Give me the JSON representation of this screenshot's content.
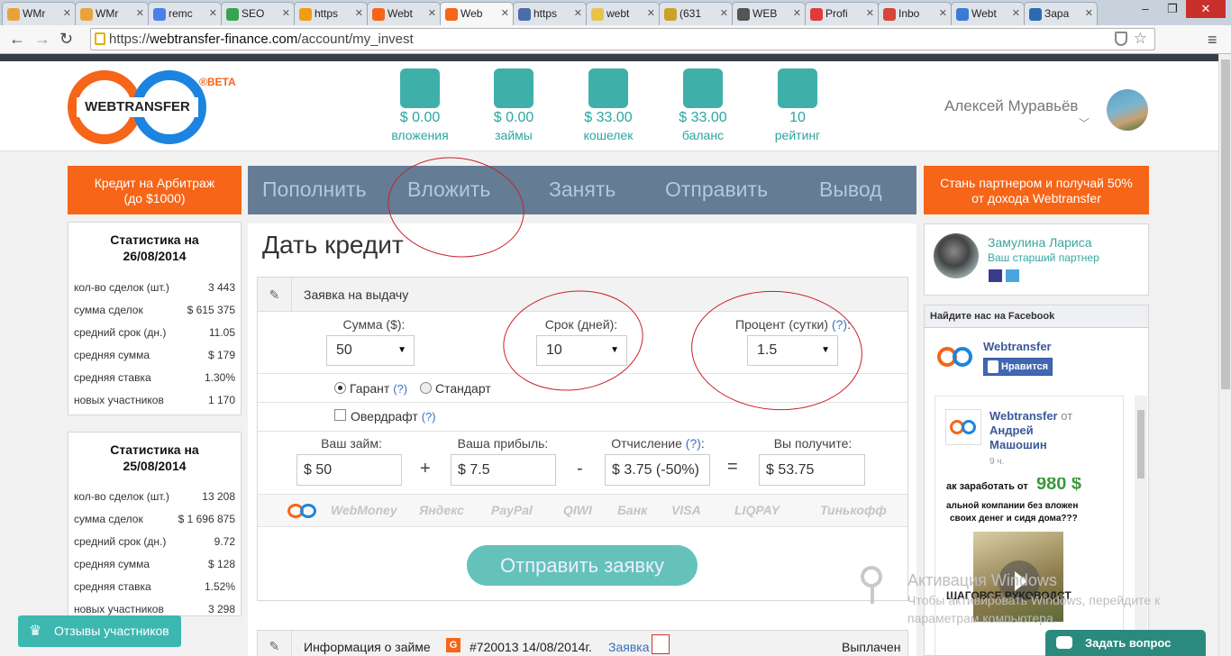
{
  "browser": {
    "tabs": [
      {
        "label": "WMr",
        "favcolor": "#e9a23b"
      },
      {
        "label": "WMr",
        "favcolor": "#e9a23b"
      },
      {
        "label": "remc",
        "favcolor": "#4a80e8"
      },
      {
        "label": "SEO",
        "favcolor": "#3aa351"
      },
      {
        "label": "https",
        "favcolor": "#f39c12"
      },
      {
        "label": "Webt",
        "favcolor": "#f66518"
      },
      {
        "label": "Web",
        "favcolor": "#f66518"
      },
      {
        "label": "https",
        "favcolor": "#4a6ea8"
      },
      {
        "label": "webt",
        "favcolor": "#e8c34a"
      },
      {
        "label": "(631",
        "favcolor": "#c9a227"
      },
      {
        "label": "WEB",
        "favcolor": "#555555"
      },
      {
        "label": "Profi",
        "favcolor": "#e23b3b"
      },
      {
        "label": "Inbo",
        "favcolor": "#d44638"
      },
      {
        "label": "Webt",
        "favcolor": "#3a7bd5"
      },
      {
        "label": "Зара",
        "favcolor": "#2b6cb0"
      }
    ],
    "active_tab": 6,
    "url_scheme": "https://",
    "url_host": "webtransfer-finance.com",
    "url_path": "/account/my_invest",
    "window_controls": {
      "minimize": "–",
      "maximize": "❐",
      "close": "✕"
    }
  },
  "header": {
    "logo_text": "WEBTRANSFER",
    "logo_badge": "®BETA",
    "stats": [
      {
        "icon": "piggy-bank-icon",
        "value": "$ 0.00",
        "label": "вложения"
      },
      {
        "icon": "coins-icon",
        "value": "$ 0.00",
        "label": "займы"
      },
      {
        "icon": "safe-icon",
        "value": "$ 33.00",
        "label": "кошелек"
      },
      {
        "icon": "abacus-icon",
        "value": "$ 33.00",
        "label": "баланс"
      },
      {
        "icon": "rating-chart-icon",
        "value": "10",
        "label": "рейтинг"
      }
    ],
    "user_name": "Алексей Муравьёв"
  },
  "promo_left": {
    "line1": "Кредит на Арбитраж",
    "line2": "(до $1000)"
  },
  "promo_right": {
    "line1": "Стань партнером и получай 50%",
    "line2": "от дохода Webtransfer"
  },
  "nav": [
    "Пополнить",
    "Вложить",
    "Занять",
    "Отправить",
    "Вывод"
  ],
  "stats_panels": [
    {
      "title1": "Статистика на",
      "title2": "26/08/2014",
      "rows": [
        {
          "label": "кол-во сделок (шт.)",
          "value": "3 443"
        },
        {
          "label": "сумма сделок",
          "value": "$ 615 375"
        },
        {
          "label": "средний срок (дн.)",
          "value": "11.05"
        },
        {
          "label": "средняя сумма",
          "value": "$ 179"
        },
        {
          "label": "средняя ставка",
          "value": "1.30%"
        },
        {
          "label": "новых участников",
          "value": "1 170"
        }
      ]
    },
    {
      "title1": "Статистика на",
      "title2": "25/08/2014",
      "rows": [
        {
          "label": "кол-во сделок (шт.)",
          "value": "13 208"
        },
        {
          "label": "сумма сделок",
          "value": "$ 1 696 875"
        },
        {
          "label": "средний срок (дн.)",
          "value": "9.72"
        },
        {
          "label": "средняя сумма",
          "value": "$ 128"
        },
        {
          "label": "средняя ставка",
          "value": "1.52%"
        },
        {
          "label": "новых участников",
          "value": "3 298"
        }
      ]
    }
  ],
  "reviews_button": "Отзывы участников",
  "main": {
    "title": "Дать кредит",
    "section_title": "Заявка на выдачу",
    "sum_label": "Сумма ($):",
    "sum_value": "50",
    "term_label": "Срок (дней):",
    "term_value": "10",
    "percent_label": "Процент (сутки)",
    "percent_help": "(?)",
    "percent_colon": ":",
    "percent_value": "1.5",
    "guarantee_label": "Гарант",
    "guarantee_help": "(?)",
    "standard_label": "Стандарт",
    "overdraft_label": "Овердрафт",
    "overdraft_help": "(?)",
    "loan_label": "Ваш займ:",
    "loan_value": "$ 50",
    "profit_label": "Ваша прибыль:",
    "profit_value": "$ 7.5",
    "fee_label": "Отчисление",
    "fee_help": "(?)",
    "fee_colon": ":",
    "fee_value": "$ 3.75 (-50%)",
    "receive_label": "Вы получите:",
    "receive_value": "$ 53.75",
    "op_plus": "+",
    "op_minus": "-",
    "op_equals": "=",
    "pay_methods": [
      "WebMoney",
      "Яндекс",
      "PayPal",
      "QIWI",
      "Банк",
      "VISA",
      "LIQPAY",
      "Тинькофф"
    ],
    "submit_label": "Отправить заявку",
    "info_title": "Информация о займе",
    "info_badge": "G",
    "info_number": "#720013 14/08/2014г.",
    "info_link": "Заявка",
    "info_status": "Выплачен"
  },
  "partner": {
    "name": "Замулина Лариса",
    "role": "Ваш старший партнер"
  },
  "facebook": {
    "header": "Найдите нас на Facebook",
    "page_name": "Webtransfer",
    "like_label": "Нравится",
    "post_author": "Webtransfer",
    "post_from": "от",
    "post_from_name1": "Андрей",
    "post_from_name2": "Машошин",
    "post_time": "9 ч.",
    "post_amount": "980 $",
    "post_line1": "ак заработать от",
    "post_line2": "альной компании без вложен",
    "post_line3": "своих денег и сидя дома???",
    "post_line4": "ШАГОВСЕ РУКОВОДСТ"
  },
  "activation": {
    "title": "Активация Windows",
    "line1": "Чтобы активировать Windows, перейдите к",
    "line2": "параметрам компьютера."
  },
  "ask_button": "Задать вопрос",
  "colors": {
    "orange": "#f66518",
    "teal": "#2aa6a0",
    "nav_bg": "#657c95",
    "blue_link": "#3a6fc1"
  }
}
